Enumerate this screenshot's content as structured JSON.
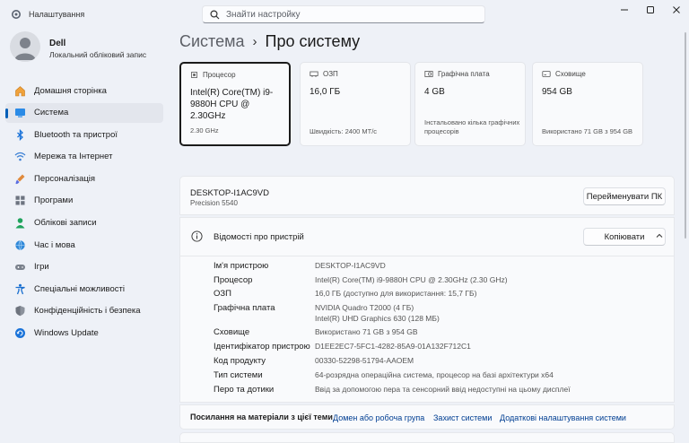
{
  "window": {
    "title": "Налаштування",
    "search_placeholder": "Знайти настройку"
  },
  "user": {
    "name": "Dell",
    "account_type": "Локальний обліковий запис"
  },
  "sidebar": {
    "items": [
      {
        "label": "Домашня сторінка",
        "icon": "home-icon"
      },
      {
        "label": "Система",
        "icon": "system-icon",
        "active": true
      },
      {
        "label": "Bluetooth та пристрої",
        "icon": "bluetooth-icon"
      },
      {
        "label": "Мережа та Інтернет",
        "icon": "wifi-icon"
      },
      {
        "label": "Персоналізація",
        "icon": "brush-icon"
      },
      {
        "label": "Програми",
        "icon": "apps-icon"
      },
      {
        "label": "Облікові записи",
        "icon": "accounts-icon"
      },
      {
        "label": "Час і мова",
        "icon": "globe-clock-icon"
      },
      {
        "label": "Ігри",
        "icon": "gamepad-icon"
      },
      {
        "label": "Спеціальні можливості",
        "icon": "accessibility-icon"
      },
      {
        "label": "Конфіденційність і безпека",
        "icon": "shield-icon"
      },
      {
        "label": "Windows Update",
        "icon": "update-icon"
      }
    ]
  },
  "breadcrumb": {
    "parent": "Система",
    "current": "Про систему"
  },
  "cards": [
    {
      "head": "Процесор",
      "value": "Intel(R) Core(TM) i9-9880H CPU @ 2.30GHz",
      "sub": "2.30 GHz",
      "icon": "cpu-icon"
    },
    {
      "head": "ОЗП",
      "value": "16,0 ГБ",
      "sub": "Швидкість: 2400 MT/с",
      "icon": "ram-icon"
    },
    {
      "head": "Графічна плата",
      "value": "4 GB",
      "sub": "Інстальовано кілька графічних процесорів",
      "icon": "gpu-icon"
    },
    {
      "head": "Сховище",
      "value": "954 GB",
      "sub": "Використано 71 GB з 954 GB",
      "icon": "storage-icon"
    }
  ],
  "device": {
    "hostname": "DESKTOP-I1AC9VD",
    "model": "Precision 5540",
    "rename_label": "Перейменувати ПК"
  },
  "specs": {
    "title": "Відомості про пристрій",
    "copy_label": "Копіювати",
    "rows": [
      {
        "label": "Ім'я пристрою",
        "value": "DESKTOP-I1AC9VD"
      },
      {
        "label": "Процесор",
        "value": "Intel(R) Core(TM) i9-9880H CPU @ 2.30GHz (2.30 GHz)"
      },
      {
        "label": "ОЗП",
        "value": "16,0 ГБ (доступно для використання: 15,7 ГБ)"
      },
      {
        "label": "Графічна плата",
        "value": "NVIDIA Quadro T2000 (4 ГБ)",
        "value2": "Intel(R) UHD Graphics 630 (128 МБ)"
      },
      {
        "label": "Сховище",
        "value": "Використано 71 GB з 954 GB"
      },
      {
        "label": "Ідентифікатор пристрою",
        "value": "D1EE2EC7-5FC1-4282-85A9-01A132F712C1"
      },
      {
        "label": "Код продукту",
        "value": "00330-52298-51794-AAOEM"
      },
      {
        "label": "Тип системи",
        "value": "64-розрядна операційна система, процесор на базі архітектури x64"
      },
      {
        "label": "Перо та дотики",
        "value": "Ввід за допомогою пера та сенсорний ввід недоступні на цьому дисплеї"
      }
    ]
  },
  "related": {
    "title": "Посилання на матеріали з цієї теми",
    "links": [
      "Домен або робоча група",
      "Захист системи",
      "Додаткові налаштування системи"
    ]
  }
}
